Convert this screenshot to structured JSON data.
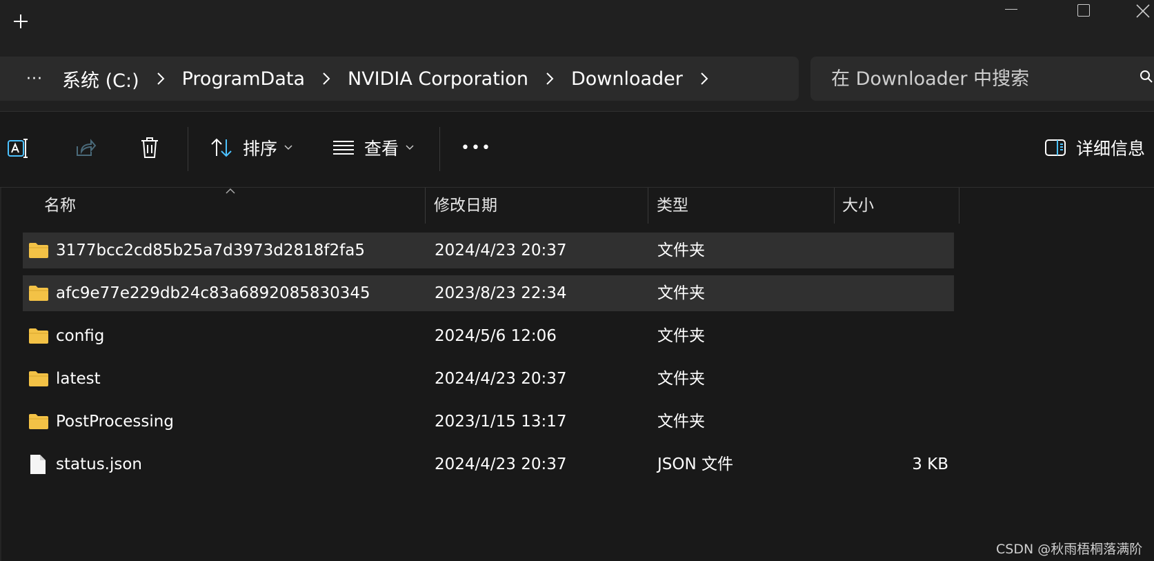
{
  "breadcrumb": {
    "more": "···",
    "items": [
      "系统 (C:)",
      "ProgramData",
      "NVIDIA Corporation",
      "Downloader"
    ]
  },
  "search": {
    "placeholder": "在 Downloader 中搜索"
  },
  "toolbar": {
    "sort_label": "排序",
    "view_label": "查看",
    "more_label": "•••",
    "details_label": "详细信息"
  },
  "columns": {
    "name": "名称",
    "modified": "修改日期",
    "type": "类型",
    "size": "大小"
  },
  "files": [
    {
      "name": "3177bcc2cd85b25a7d3973d2818f2fa5",
      "modified": "2024/4/23 20:37",
      "type": "文件夹",
      "size": "",
      "icon": "folder-icon",
      "selected": true
    },
    {
      "name": "afc9e77e229db24c83a6892085830345",
      "modified": "2023/8/23 22:34",
      "type": "文件夹",
      "size": "",
      "icon": "folder-icon",
      "selected": true
    },
    {
      "name": "config",
      "modified": "2024/5/6 12:06",
      "type": "文件夹",
      "size": "",
      "icon": "folder-icon",
      "selected": false
    },
    {
      "name": "latest",
      "modified": "2024/4/23 20:37",
      "type": "文件夹",
      "size": "",
      "icon": "folder-icon",
      "selected": false
    },
    {
      "name": "PostProcessing",
      "modified": "2023/1/15 13:17",
      "type": "文件夹",
      "size": "",
      "icon": "folder-icon",
      "selected": false
    },
    {
      "name": "status.json",
      "modified": "2024/4/23 20:37",
      "type": "JSON 文件",
      "size": "3 KB",
      "icon": "file-icon",
      "selected": false
    }
  ],
  "watermark": "CSDN @秋雨梧桐落满阶",
  "colors": {
    "background": "#191919",
    "panel": "#2b2b2b",
    "selected_row": "#303030",
    "accent": "#4cc2ff",
    "folder": "#f3c246"
  }
}
